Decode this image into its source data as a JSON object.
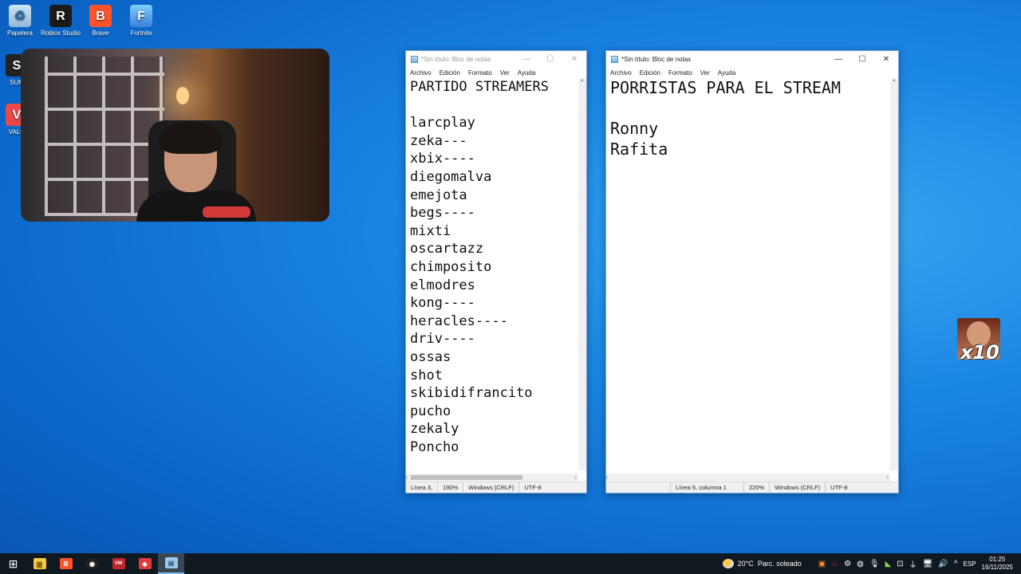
{
  "desktop": {
    "icons": [
      {
        "label": "Papelera",
        "glyph": "♻"
      },
      {
        "label": "Roblox Studio",
        "glyph": "R"
      },
      {
        "label": "Brave",
        "glyph": "B"
      },
      {
        "label": "Fortnite",
        "glyph": "F"
      },
      {
        "label": "SUM",
        "glyph": "S"
      },
      {
        "label": "VALO",
        "glyph": "V"
      }
    ]
  },
  "notepad_left": {
    "title": "*Sin título: Bloc de notas",
    "menu": [
      "Archivo",
      "Edición",
      "Formato",
      "Ver",
      "Ayuda"
    ],
    "content": "PARTIDO STREAMERS\n\nlarcplay\nzeka---\nxbix----\ndiegomalva\nemejota\nbegs----\nmixti\noscartazz\nchimposito\nelmodres\nkong----\nheracles----\ndriv----\nossas\nshot\nskibidifrancito\npucho\nzekaly\nPoncho",
    "status": {
      "position": "Línea 3,",
      "zoom": "190%",
      "eol": "Windows (CRLF)",
      "encoding": "UTF-8"
    }
  },
  "notepad_right": {
    "title": "*Sin título: Bloc de notas",
    "menu": [
      "Archivo",
      "Edición",
      "Formato",
      "Ver",
      "Ayuda"
    ],
    "content": "PORRISTAS PARA EL STREAM\n\nRonny\nRafita",
    "status": {
      "position": "Línea 5, columna 1",
      "zoom": "220%",
      "eol": "Windows (CRLF)",
      "encoding": "UTF-8"
    }
  },
  "emote": {
    "count": "x10"
  },
  "taskbar": {
    "apps": [
      {
        "name": "file-explorer",
        "glyph": "▆",
        "color": "#f2c744"
      },
      {
        "name": "brave",
        "glyph": "B",
        "color": "#fb542b"
      },
      {
        "name": "obs",
        "glyph": "◉",
        "color": "#ffffff"
      },
      {
        "name": "voicemeeter",
        "glyph": "VM",
        "color": "#c2272d"
      },
      {
        "name": "app-red",
        "glyph": "◆",
        "color": "#e03a3a"
      },
      {
        "name": "notepad",
        "glyph": "▤",
        "color": "#9cc8ea"
      }
    ],
    "weather": {
      "temp": "20°C",
      "desc": "Parc. soleado"
    },
    "language": "ESP",
    "time": "01:25",
    "date": "16/11/2025"
  }
}
